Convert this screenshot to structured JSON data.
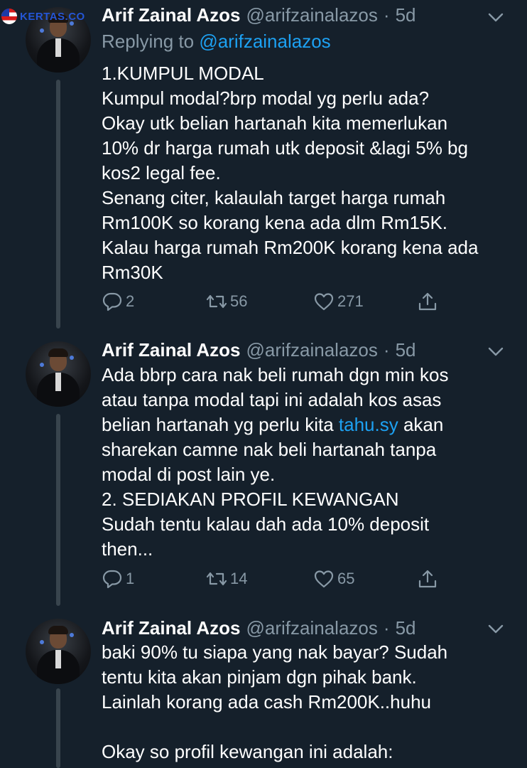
{
  "watermark": {
    "text": "KERTAS.CO"
  },
  "tweets": [
    {
      "name": "Arif Zainal Azos",
      "handle": "@arifzainalazos",
      "separator": "·",
      "time": "5d",
      "replying_label": "Replying to",
      "replying_handle": "@arifzainalazos",
      "lines": [
        "1.KUMPUL MODAL",
        "Kumpul modal?brp modal yg perlu ada?",
        "Okay utk belian hartanah kita memerlukan",
        "10% dr harga rumah utk deposit &lagi 5% bg",
        "kos2 legal fee.",
        "Senang citer, kalaulah target harga rumah",
        "Rm100K so korang kena ada dlm Rm15K.",
        "Kalau harga rumah Rm200K korang kena ada",
        "Rm30K"
      ],
      "replies": "2",
      "retweets": "56",
      "likes": "271"
    },
    {
      "name": "Arif Zainal Azos",
      "handle": "@arifzainalazos",
      "separator": "·",
      "time": "5d",
      "lines_before_link": "Ada bbrp cara nak beli rumah dgn min kos\natau tanpa modal tapi ini adalah kos asas\nbelian hartanah yg perlu kita ",
      "link": "tahu.sy",
      "lines_after_link": " akan\nsharekan camne nak beli hartanah tanpa\nmodal di post lain ye.\n2. SEDIAKAN PROFIL KEWANGAN\nSudah tentu kalau dah ada 10% deposit\nthen...",
      "replies": "1",
      "retweets": "14",
      "likes": "65"
    },
    {
      "name": "Arif Zainal Azos",
      "handle": "@arifzainalazos",
      "separator": "·",
      "time": "5d",
      "text": "baki 90% tu siapa yang nak bayar? Sudah\ntentu kita akan pinjam dgn pihak bank.\nLainlah korang ada cash Rm200K..huhu\n\nOkay so profil kewangan ini adalah:"
    }
  ],
  "colors": {
    "background": "#15202b",
    "text": "#ffffff",
    "muted": "#8899a6",
    "link": "#1da1f2",
    "thread_line": "#38444d"
  }
}
